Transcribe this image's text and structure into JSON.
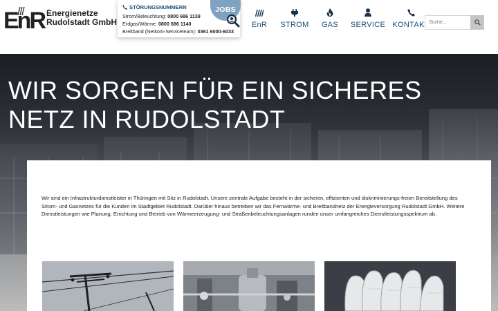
{
  "brand": {
    "logo_letters": "EnR",
    "name_line1": "Energienetze",
    "name_line2": "Rudolstadt GmbH"
  },
  "stoerung": {
    "title": "STÖRUNGSNUMMERN",
    "rows": [
      {
        "label": "Strom/Beleuchtung:",
        "number": "0800 686 1139"
      },
      {
        "label": "Erdgas/Wärme:",
        "number": "0800 686 1140"
      },
      {
        "label": "Breitband (Netkom-Serviceteam):",
        "number": "0361 6000-6033"
      }
    ]
  },
  "jobs": {
    "label": "JOBS",
    "icon": "magnifier-icon"
  },
  "nav": [
    {
      "label": "EnR",
      "icon": "enr-hatch-icon"
    },
    {
      "label": "STROM",
      "icon": "plug-icon"
    },
    {
      "label": "GAS",
      "icon": "flame-icon"
    },
    {
      "label": "SERVICE",
      "icon": "user-icon"
    },
    {
      "label": "KONTAKT",
      "icon": "phone-icon"
    }
  ],
  "search": {
    "placeholder": "Suche...",
    "icon": "search-icon"
  },
  "hero": {
    "title": "WIR SORGEN FÜR EIN SICHERES NETZ IN RUDOLSTADT"
  },
  "intro": {
    "text": "Wir sind ein Infrastrukturdienstleister in Thüringen mit Sitz in Rudolstadt. Unsere zentrale Aufgabe besteht in der sicheren, effizienten und diskriminierungs-freien Bereitstellung des Strom- und Gasnetzes für die Kunden im Stadtgebiet Rudolstadt. Darüber hinaus betreiben wir das Fernwärme- und Breitbandnetz der Energieversorgung Rudolstadt GmbH. Weitere Dienstleistungen wie Planung, Errichtung und Betrieb von Wärmeerzeugung- und Straßenbeleuchtungsanlagen runden unser umfangreiches Dienstleistungsspektrum ab."
  },
  "colors": {
    "brand_blue": "#1a4d74",
    "jobs_blue": "#7ea2c0",
    "hero_dark": "#20222a"
  }
}
